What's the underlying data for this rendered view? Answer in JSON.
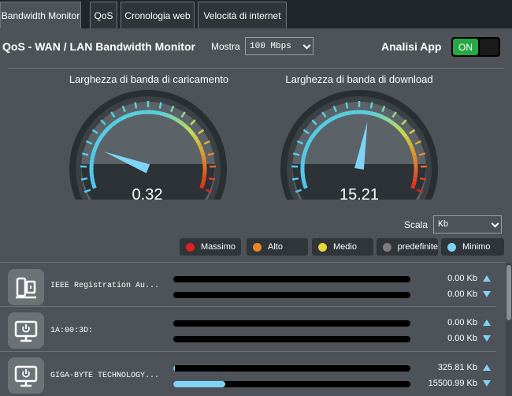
{
  "tabs": [
    {
      "label": "Bandwidth Monitor",
      "active": true
    },
    {
      "label": "QoS",
      "active": false
    },
    {
      "label": "Cronologia web",
      "active": false
    },
    {
      "label": "Velocità di internet",
      "active": false
    }
  ],
  "header": {
    "title": "QoS - WAN / LAN Bandwidth Monitor",
    "show_label": "Mostra",
    "show_value": "100 Mbps",
    "app_analysis_label": "Analisi App",
    "app_analysis_toggle": "ON"
  },
  "gauges": {
    "upload": {
      "label": "Larghezza di banda di caricamento",
      "value": "0.32",
      "level": 0.0032
    },
    "download": {
      "label": "Larghezza di banda di download",
      "value": "15.21",
      "level": 0.1521
    }
  },
  "scale": {
    "label": "Scala",
    "value": "Kb"
  },
  "legend": [
    {
      "label": "Massimo",
      "color": "#e0201e"
    },
    {
      "label": "Alto",
      "color": "#e8862a"
    },
    {
      "label": "Medio",
      "color": "#e8d83a"
    },
    {
      "label": "predefinite",
      "color": "#7d7d7d"
    },
    {
      "label": "Minimo",
      "color": "#7fd3f7"
    }
  ],
  "devices": [
    {
      "name": "IEEE Registration Au...",
      "icon": "device-icon",
      "upload": "0.00 Kb",
      "download": "0.00 Kb",
      "upload_level": 0,
      "download_level": 0
    },
    {
      "name": "1A:00:3D:",
      "icon": "monitor-power-icon",
      "upload": "0.00 Kb",
      "download": "0.00 Kb",
      "upload_level": 0,
      "download_level": 0
    },
    {
      "name": "GIGA-BYTE TECHNOLOGY...",
      "icon": "monitor-power-icon",
      "upload": "325.81 Kb",
      "download": "15500.99 Kb",
      "upload_level": 0.007,
      "download_level": 0.22
    }
  ]
}
